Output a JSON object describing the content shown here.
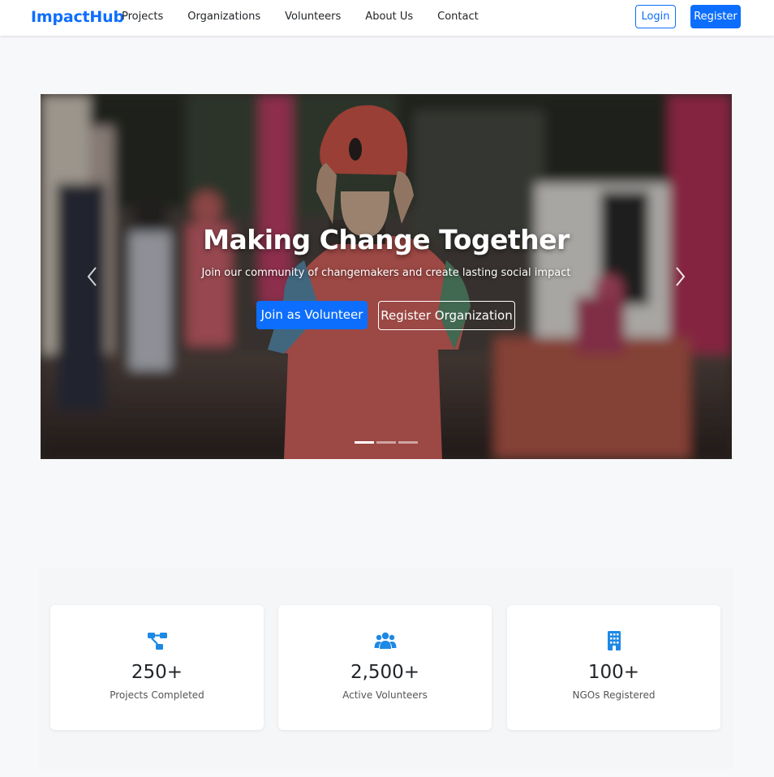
{
  "colors": {
    "primary": "#0d6efd",
    "icon_blue": "#1e88e5",
    "page_bg": "#f7f8fa"
  },
  "navbar": {
    "brand": "ImpactHub",
    "links": [
      "Projects",
      "Organizations",
      "Volunteers",
      "About Us",
      "Contact"
    ],
    "login_label": "Login",
    "register_label": "Register"
  },
  "hero": {
    "title": "Making Change Together",
    "subtitle": "Join our community of changemakers and create lasting social impact",
    "primary_button": "Join as Volunteer",
    "secondary_button": "Register Organization",
    "prev_icon": "chevron-left-icon",
    "next_icon": "chevron-right-icon",
    "slide_count": 3,
    "active_slide": 1
  },
  "stats": [
    {
      "icon": "project-diagram-icon",
      "value": "250+",
      "label": "Projects Completed"
    },
    {
      "icon": "users-icon",
      "value": "2,500+",
      "label": "Active Volunteers"
    },
    {
      "icon": "building-icon",
      "value": "100+",
      "label": "NGOs Registered"
    }
  ]
}
